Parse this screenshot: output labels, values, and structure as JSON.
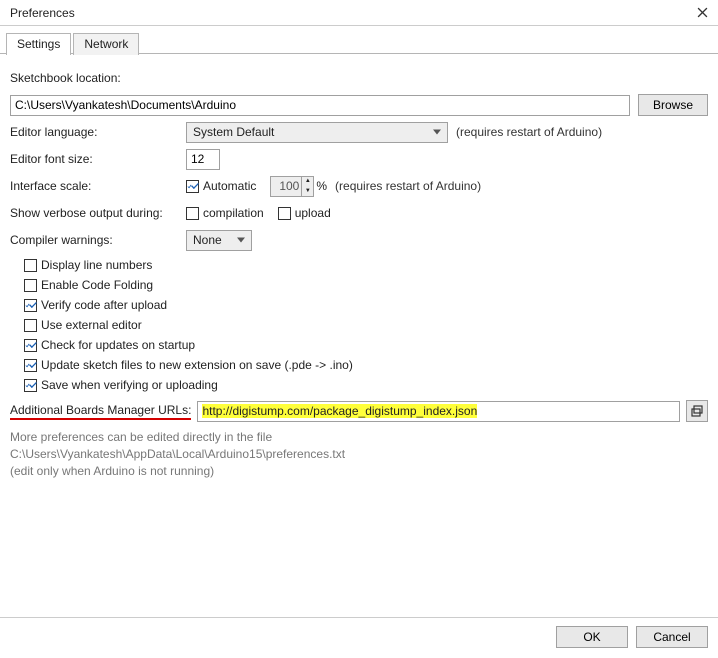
{
  "window": {
    "title": "Preferences"
  },
  "tabs": {
    "settings": "Settings",
    "network": "Network"
  },
  "sketchbook": {
    "label": "Sketchbook location:",
    "path": "C:\\Users\\Vyankatesh\\Documents\\Arduino",
    "browse": "Browse"
  },
  "lang": {
    "label": "Editor language:",
    "value": "System Default",
    "note": "(requires restart of Arduino)"
  },
  "fontsize": {
    "label": "Editor font size:",
    "value": "12"
  },
  "scale": {
    "label": "Interface scale:",
    "auto": "Automatic",
    "value": "100",
    "pct": "%",
    "note": "(requires restart of Arduino)"
  },
  "verbose": {
    "label": "Show verbose output during:",
    "compilation": "compilation",
    "upload": "upload"
  },
  "compiler": {
    "label": "Compiler warnings:",
    "value": "None"
  },
  "opts": {
    "line_numbers": "Display line numbers",
    "code_folding": "Enable Code Folding",
    "verify_upload": "Verify code after upload",
    "external_editor": "Use external editor",
    "check_updates": "Check for updates on startup",
    "update_ext": "Update sketch files to new extension on save (.pde -> .ino)",
    "save_verify": "Save when verifying or uploading"
  },
  "urls": {
    "label": "Additional Boards Manager URLs:",
    "value": "http://digistump.com/package_digistump_index.json"
  },
  "more": {
    "line1": "More preferences can be edited directly in the file",
    "path": "C:\\Users\\Vyankatesh\\AppData\\Local\\Arduino15\\preferences.txt",
    "line3": "(edit only when Arduino is not running)"
  },
  "buttons": {
    "ok": "OK",
    "cancel": "Cancel"
  }
}
